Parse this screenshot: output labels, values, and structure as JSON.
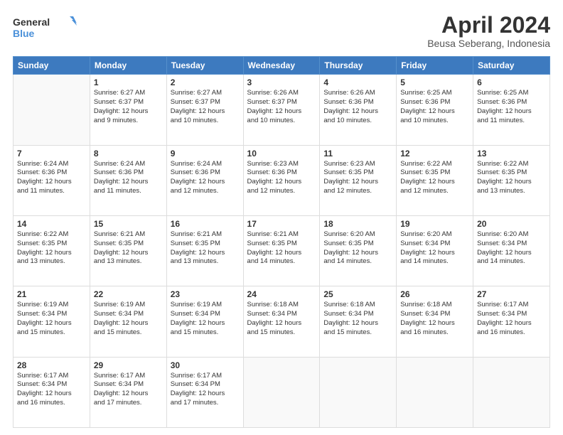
{
  "logo": {
    "line1": "General",
    "line2": "Blue"
  },
  "title": "April 2024",
  "subtitle": "Beusa Seberang, Indonesia",
  "days_header": [
    "Sunday",
    "Monday",
    "Tuesday",
    "Wednesday",
    "Thursday",
    "Friday",
    "Saturday"
  ],
  "weeks": [
    [
      {
        "num": "",
        "info": ""
      },
      {
        "num": "1",
        "info": "Sunrise: 6:27 AM\nSunset: 6:37 PM\nDaylight: 12 hours\nand 9 minutes."
      },
      {
        "num": "2",
        "info": "Sunrise: 6:27 AM\nSunset: 6:37 PM\nDaylight: 12 hours\nand 10 minutes."
      },
      {
        "num": "3",
        "info": "Sunrise: 6:26 AM\nSunset: 6:37 PM\nDaylight: 12 hours\nand 10 minutes."
      },
      {
        "num": "4",
        "info": "Sunrise: 6:26 AM\nSunset: 6:36 PM\nDaylight: 12 hours\nand 10 minutes."
      },
      {
        "num": "5",
        "info": "Sunrise: 6:25 AM\nSunset: 6:36 PM\nDaylight: 12 hours\nand 10 minutes."
      },
      {
        "num": "6",
        "info": "Sunrise: 6:25 AM\nSunset: 6:36 PM\nDaylight: 12 hours\nand 11 minutes."
      }
    ],
    [
      {
        "num": "7",
        "info": "Sunrise: 6:24 AM\nSunset: 6:36 PM\nDaylight: 12 hours\nand 11 minutes."
      },
      {
        "num": "8",
        "info": "Sunrise: 6:24 AM\nSunset: 6:36 PM\nDaylight: 12 hours\nand 11 minutes."
      },
      {
        "num": "9",
        "info": "Sunrise: 6:24 AM\nSunset: 6:36 PM\nDaylight: 12 hours\nand 12 minutes."
      },
      {
        "num": "10",
        "info": "Sunrise: 6:23 AM\nSunset: 6:36 PM\nDaylight: 12 hours\nand 12 minutes."
      },
      {
        "num": "11",
        "info": "Sunrise: 6:23 AM\nSunset: 6:35 PM\nDaylight: 12 hours\nand 12 minutes."
      },
      {
        "num": "12",
        "info": "Sunrise: 6:22 AM\nSunset: 6:35 PM\nDaylight: 12 hours\nand 12 minutes."
      },
      {
        "num": "13",
        "info": "Sunrise: 6:22 AM\nSunset: 6:35 PM\nDaylight: 12 hours\nand 13 minutes."
      }
    ],
    [
      {
        "num": "14",
        "info": "Sunrise: 6:22 AM\nSunset: 6:35 PM\nDaylight: 12 hours\nand 13 minutes."
      },
      {
        "num": "15",
        "info": "Sunrise: 6:21 AM\nSunset: 6:35 PM\nDaylight: 12 hours\nand 13 minutes."
      },
      {
        "num": "16",
        "info": "Sunrise: 6:21 AM\nSunset: 6:35 PM\nDaylight: 12 hours\nand 13 minutes."
      },
      {
        "num": "17",
        "info": "Sunrise: 6:21 AM\nSunset: 6:35 PM\nDaylight: 12 hours\nand 14 minutes."
      },
      {
        "num": "18",
        "info": "Sunrise: 6:20 AM\nSunset: 6:35 PM\nDaylight: 12 hours\nand 14 minutes."
      },
      {
        "num": "19",
        "info": "Sunrise: 6:20 AM\nSunset: 6:34 PM\nDaylight: 12 hours\nand 14 minutes."
      },
      {
        "num": "20",
        "info": "Sunrise: 6:20 AM\nSunset: 6:34 PM\nDaylight: 12 hours\nand 14 minutes."
      }
    ],
    [
      {
        "num": "21",
        "info": "Sunrise: 6:19 AM\nSunset: 6:34 PM\nDaylight: 12 hours\nand 15 minutes."
      },
      {
        "num": "22",
        "info": "Sunrise: 6:19 AM\nSunset: 6:34 PM\nDaylight: 12 hours\nand 15 minutes."
      },
      {
        "num": "23",
        "info": "Sunrise: 6:19 AM\nSunset: 6:34 PM\nDaylight: 12 hours\nand 15 minutes."
      },
      {
        "num": "24",
        "info": "Sunrise: 6:18 AM\nSunset: 6:34 PM\nDaylight: 12 hours\nand 15 minutes."
      },
      {
        "num": "25",
        "info": "Sunrise: 6:18 AM\nSunset: 6:34 PM\nDaylight: 12 hours\nand 15 minutes."
      },
      {
        "num": "26",
        "info": "Sunrise: 6:18 AM\nSunset: 6:34 PM\nDaylight: 12 hours\nand 16 minutes."
      },
      {
        "num": "27",
        "info": "Sunrise: 6:17 AM\nSunset: 6:34 PM\nDaylight: 12 hours\nand 16 minutes."
      }
    ],
    [
      {
        "num": "28",
        "info": "Sunrise: 6:17 AM\nSunset: 6:34 PM\nDaylight: 12 hours\nand 16 minutes."
      },
      {
        "num": "29",
        "info": "Sunrise: 6:17 AM\nSunset: 6:34 PM\nDaylight: 12 hours\nand 17 minutes."
      },
      {
        "num": "30",
        "info": "Sunrise: 6:17 AM\nSunset: 6:34 PM\nDaylight: 12 hours\nand 17 minutes."
      },
      {
        "num": "",
        "info": ""
      },
      {
        "num": "",
        "info": ""
      },
      {
        "num": "",
        "info": ""
      },
      {
        "num": "",
        "info": ""
      }
    ]
  ]
}
